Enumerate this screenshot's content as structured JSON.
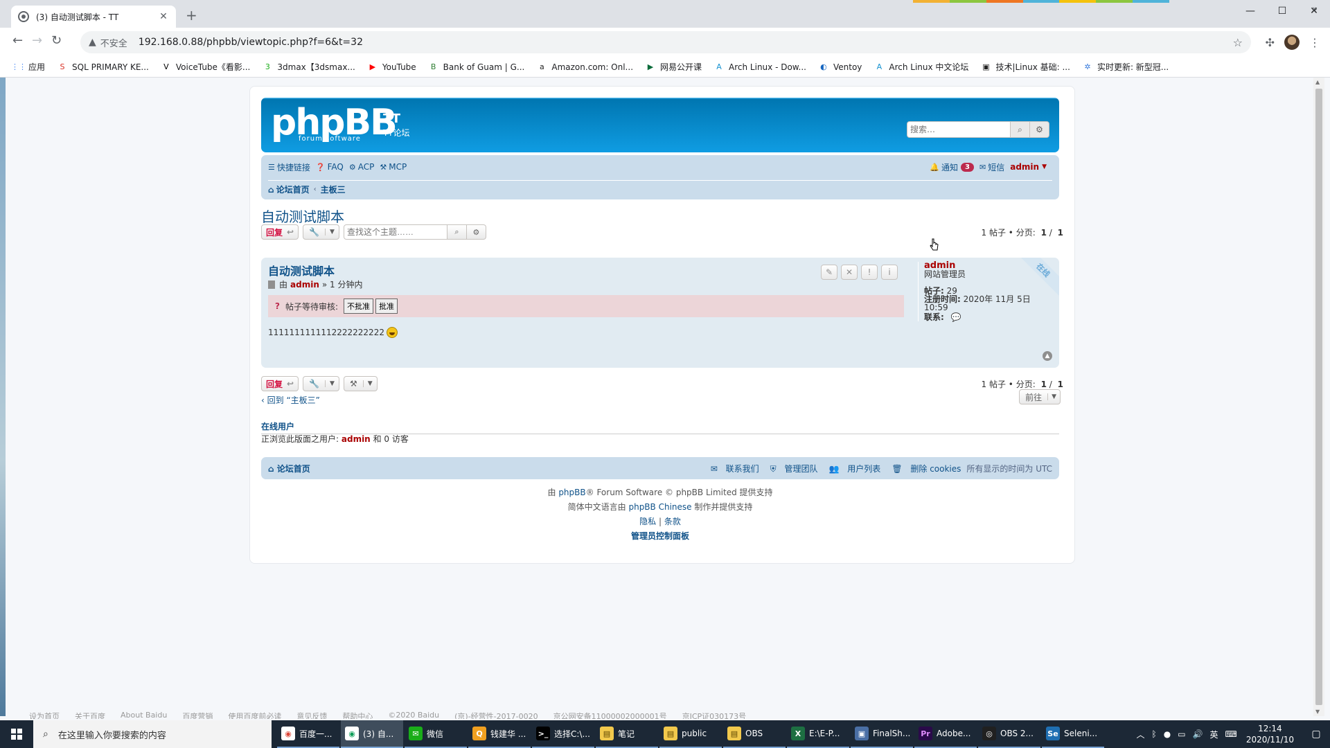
{
  "browser": {
    "tab_title": "(3) 自动测试脚本 - TT",
    "tab_close": "✕",
    "new_tab": "+",
    "security_label": "不安全",
    "url": "192.168.0.88/phpbb/viewtopic.php?f=6&t=32",
    "bookmarks": [
      {
        "label": "应用",
        "icon_color": "#4285f4",
        "icon": "⋮⋮"
      },
      {
        "label": "SQL PRIMARY KE...",
        "icon_color": "#d93025",
        "icon": "S"
      },
      {
        "label": "VoiceTube《看影...",
        "icon_color": "#000000",
        "icon": "V"
      },
      {
        "label": "3dmax【3dsmax...",
        "icon_color": "#1aad19",
        "icon": "3"
      },
      {
        "label": "YouTube",
        "icon_color": "#ff0000",
        "icon": "▶"
      },
      {
        "label": "Bank of Guam | G...",
        "icon_color": "#2e7d32",
        "icon": "B"
      },
      {
        "label": "Amazon.com: Onl...",
        "icon_color": "#222222",
        "icon": "a"
      },
      {
        "label": "网易公开课",
        "icon_color": "#0b6b3a",
        "icon": "▶"
      },
      {
        "label": "Arch Linux - Dow...",
        "icon_color": "#1793d1",
        "icon": "A"
      },
      {
        "label": "Ventoy",
        "icon_color": "#1565c0",
        "icon": "◐"
      },
      {
        "label": "Arch Linux 中文论坛",
        "icon_color": "#1793d1",
        "icon": "A"
      },
      {
        "label": "技术|Linux 基础: ...",
        "icon_color": "#222222",
        "icon": "▣"
      },
      {
        "label": "实时更新: 新型冠...",
        "icon_color": "#3b7ddd",
        "icon": "✲"
      }
    ],
    "bookmarks_more": "»"
  },
  "forum": {
    "logo_text": "phpBB",
    "logo_sub": "forum software",
    "site_name": "TT",
    "site_desc": "TT论坛",
    "search_placeholder": "搜索…",
    "nav": {
      "quick_links": "快捷链接",
      "faq": "FAQ",
      "acp": "ACP",
      "mcp": "MCP",
      "notifications": "通知",
      "notification_count": "3",
      "pm": "短信",
      "user": "admin"
    },
    "breadcrumb": {
      "home": "论坛首页",
      "forum": "主板三"
    },
    "topic": {
      "title": "自动测试脚本",
      "reply_label": "回复",
      "topic_search_placeholder": "查找这个主题……",
      "pagination_text": "1 帖子 • 分页:",
      "page_current": "1",
      "page_sep": "/",
      "page_total": "1"
    },
    "post": {
      "title": "自动测试脚本",
      "by": "由",
      "author": "admin",
      "time": "» 1 分钟内",
      "approve_label": "帖子等待审核:",
      "disapprove_btn": "不批准",
      "approve_btn": "批准",
      "content": "1111111111112222222222",
      "profile": {
        "name": "admin",
        "rank": "网站管理员",
        "posts_label": "帖子:",
        "posts_value": "29",
        "joined_label": "注册时间:",
        "joined_value": "2020年 11月 5日 10:59",
        "contact_label": "联系:"
      },
      "online_ribbon": "在线"
    },
    "return_link": "回到 “主板三”",
    "jump_label": "前往",
    "online": {
      "heading": "在线用户",
      "prefix": "正浏览此版面之用户:",
      "user": "admin",
      "suffix": "和 0 访客"
    },
    "footer_nav": {
      "home": "论坛首页",
      "contact": "联系我们",
      "team": "管理团队",
      "members": "用户列表",
      "delete_cookies": "删除 cookies",
      "timezone": "所有显示的时间为 UTC"
    },
    "copyright": {
      "line1_pre": "由",
      "line1_link": "phpBB",
      "line1_post": "® Forum Software © phpBB Limited 提供支持",
      "line2_pre": "简体中文语言由",
      "line2_link": "phpBB Chinese",
      "line2_post": "制作并提供支持",
      "privacy": "隐私",
      "sep": "|",
      "terms": "条款",
      "acp": "管理员控制面板"
    }
  },
  "page_bottom_links": [
    "设为首页",
    "关于百度",
    "About Baidu",
    "百度营销",
    "使用百度前必读",
    "意见反馈",
    "帮助中心",
    "©2020 Baidu",
    "(京)-经营性-2017-0020",
    "京公网安备11000002000001号",
    "京ICP证030173号"
  ],
  "taskbar": {
    "search_placeholder": "在这里输入你要搜索的内容",
    "apps": [
      {
        "label": "百度一...",
        "color": "#ffffff",
        "glyph": "◉",
        "fg": "#db4437"
      },
      {
        "label": "(3) 自...",
        "color": "#ffffff",
        "glyph": "◉",
        "fg": "#0f9d58"
      },
      {
        "label": "微信",
        "color": "#1aad19",
        "glyph": "✉",
        "fg": "#ffffff"
      },
      {
        "label": "钱建华 ...",
        "color": "#f0a020",
        "glyph": "Q",
        "fg": "#ffffff"
      },
      {
        "label": "选择C:\\...",
        "color": "#000000",
        "glyph": ">_",
        "fg": "#ffffff"
      },
      {
        "label": "笔记",
        "color": "#f2c94c",
        "glyph": "▤",
        "fg": "#5c4400"
      },
      {
        "label": "public",
        "color": "#f2c94c",
        "glyph": "▤",
        "fg": "#5c4400"
      },
      {
        "label": "OBS",
        "color": "#f2c94c",
        "glyph": "▤",
        "fg": "#5c4400"
      },
      {
        "label": "E:\\E-P...",
        "color": "#1d6f42",
        "glyph": "X",
        "fg": "#ffffff"
      },
      {
        "label": "FinalSh...",
        "color": "#4a6fa5",
        "glyph": "▣",
        "fg": "#ffffff"
      },
      {
        "label": "Adobe...",
        "color": "#2a0a4a",
        "glyph": "Pr",
        "fg": "#e08dfd"
      },
      {
        "label": "OBS 2...",
        "color": "#202020",
        "glyph": "◎",
        "fg": "#ffffff"
      },
      {
        "label": "Seleni...",
        "color": "#1f6fb2",
        "glyph": "Se",
        "fg": "#ffffff"
      }
    ],
    "ime": "英",
    "time": "12:14",
    "date": "2020/11/10"
  },
  "colors": {
    "header_blue": "#12a3eb",
    "link_blue": "#105289",
    "username_red": "#aa0000",
    "badge_red": "#bc2a4d"
  }
}
